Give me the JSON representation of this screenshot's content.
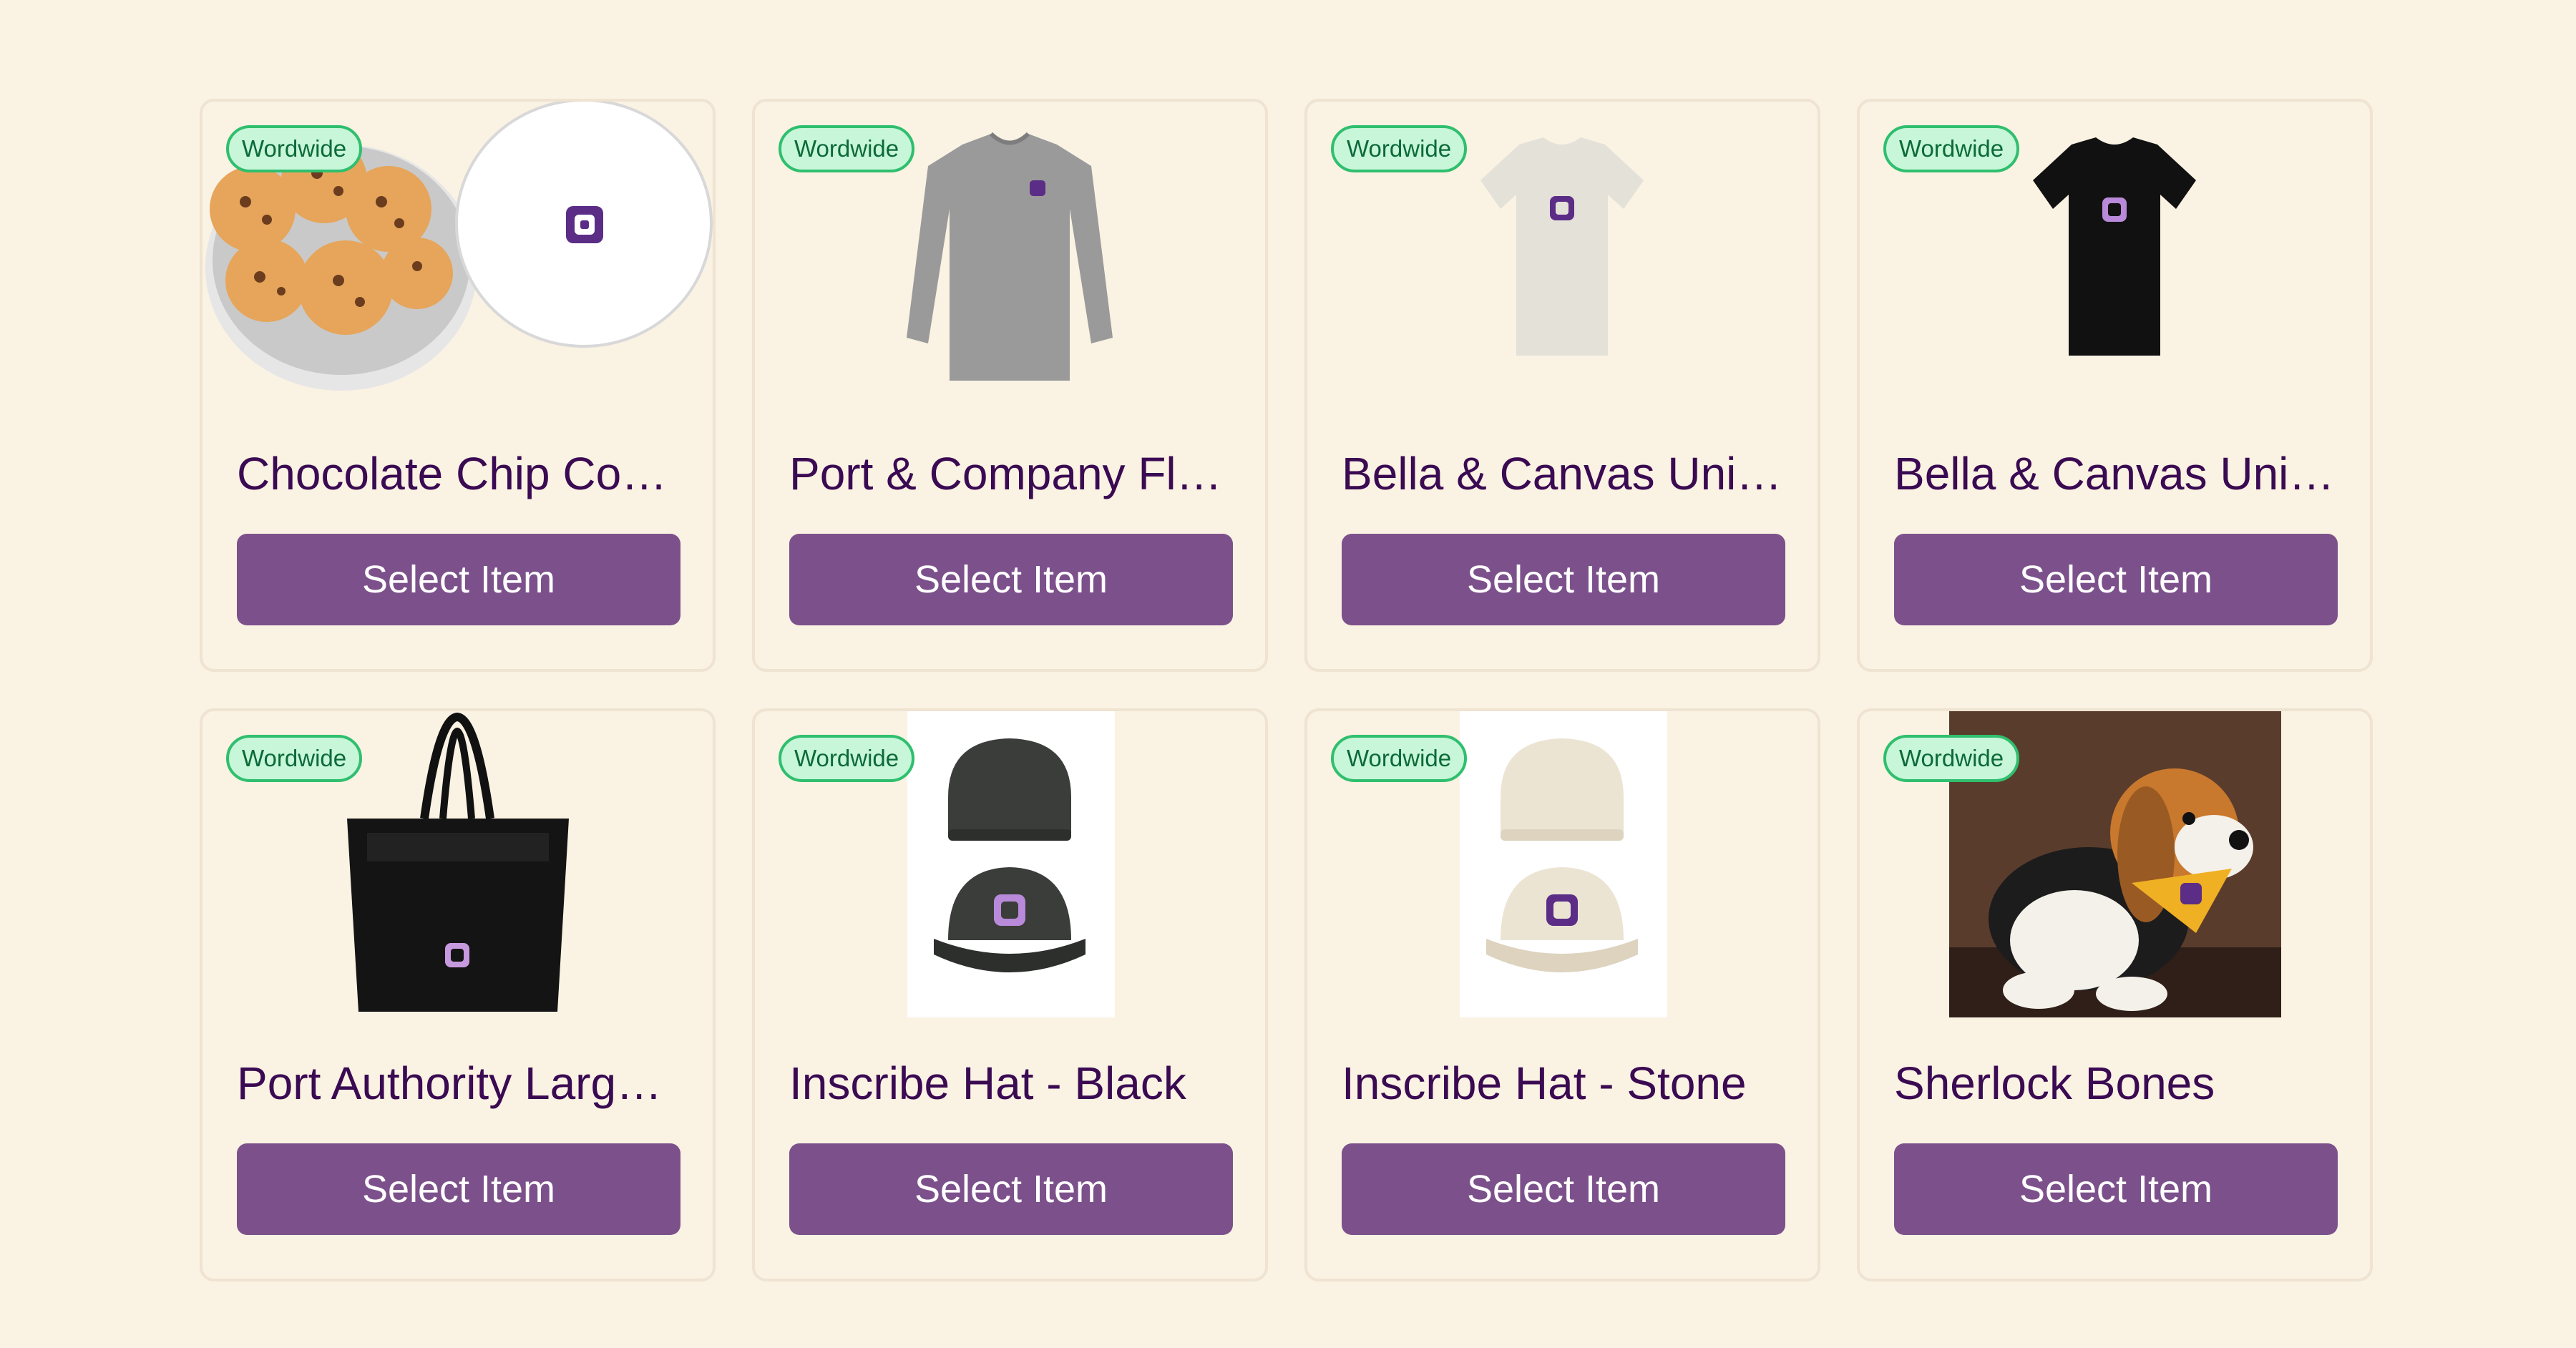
{
  "colors": {
    "page_bg": "#faf2e3",
    "button_bg": "#7c518b",
    "title_text": "#3a0a52",
    "badge_bg": "#c7f6d9",
    "badge_border": "#2fbf6e",
    "brand_logo": "#5b2d86"
  },
  "products": [
    {
      "badge": "Wordwide",
      "title": "Chocolate Chip Co…",
      "button": "Select Item",
      "image": "cookie-tin"
    },
    {
      "badge": "Wordwide",
      "title": "Port & Company Fl…",
      "button": "Select Item",
      "image": "gray-sweatshirt"
    },
    {
      "badge": "Wordwide",
      "title": "Bella & Canvas Uni…",
      "button": "Select Item",
      "image": "oatmeal-tshirt"
    },
    {
      "badge": "Wordwide",
      "title": "Bella & Canvas Uni…",
      "button": "Select Item",
      "image": "black-tshirt"
    },
    {
      "badge": "Wordwide",
      "title": "Port Authority Larg…",
      "button": "Select Item",
      "image": "black-tote-bag"
    },
    {
      "badge": "Wordwide",
      "title": "Inscribe Hat - Black",
      "button": "Select Item",
      "image": "black-cap"
    },
    {
      "badge": "Wordwide",
      "title": "Inscribe Hat - Stone",
      "button": "Select Item",
      "image": "stone-cap"
    },
    {
      "badge": "Wordwide",
      "title": "Sherlock Bones",
      "button": "Select Item",
      "image": "plush-beagle"
    }
  ]
}
